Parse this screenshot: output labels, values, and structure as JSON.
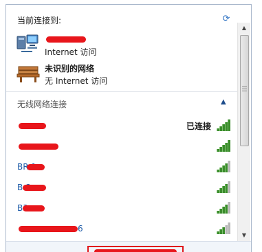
{
  "header": {
    "title": "当前连接到:",
    "refresh_icon": "refresh-icon"
  },
  "current_networks": [
    {
      "name": "",
      "access": "Internet 访问",
      "icon": "network-connected-icon"
    },
    {
      "name": "未识别的网络",
      "access": "无 Internet 访问",
      "icon": "network-bench-icon"
    }
  ],
  "wireless": {
    "section_title": "无线网络连接",
    "collapse_icon": "chevron-up-icon",
    "items": [
      {
        "ssid": "",
        "status": "已连接",
        "signal": 5
      },
      {
        "ssid": "",
        "status": "",
        "signal": 5
      },
      {
        "ssid": "BR-1",
        "status": "",
        "signal": 4
      },
      {
        "ssid": "B-2",
        "status": "",
        "signal": 4
      },
      {
        "ssid": "B3",
        "status": "",
        "signal": 4
      },
      {
        "ssid": "6",
        "status": "",
        "signal": 4
      }
    ]
  },
  "footer": {
    "label": ""
  },
  "colors": {
    "accent": "#1f5ca8",
    "signal": "#3a8c2c",
    "redaction": "#e8161b"
  }
}
